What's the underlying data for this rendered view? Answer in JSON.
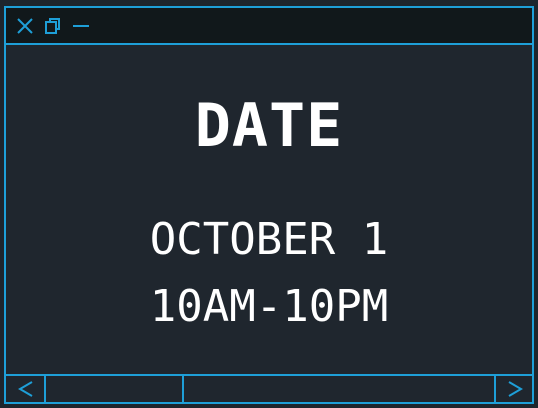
{
  "window": {
    "titlebar_icons": [
      "close-icon",
      "restore-icon",
      "minimize-icon"
    ]
  },
  "content": {
    "heading": "DATE",
    "line1": "OCTOBER 1",
    "line2": "10AM-10PM"
  },
  "bottombar": {
    "icons": [
      "chevron-left-icon",
      "chevron-right-icon"
    ]
  },
  "colors": {
    "accent": "#1e9fd8",
    "background": "#1f262e",
    "titlebar": "#11181b",
    "text": "#ffffff"
  }
}
